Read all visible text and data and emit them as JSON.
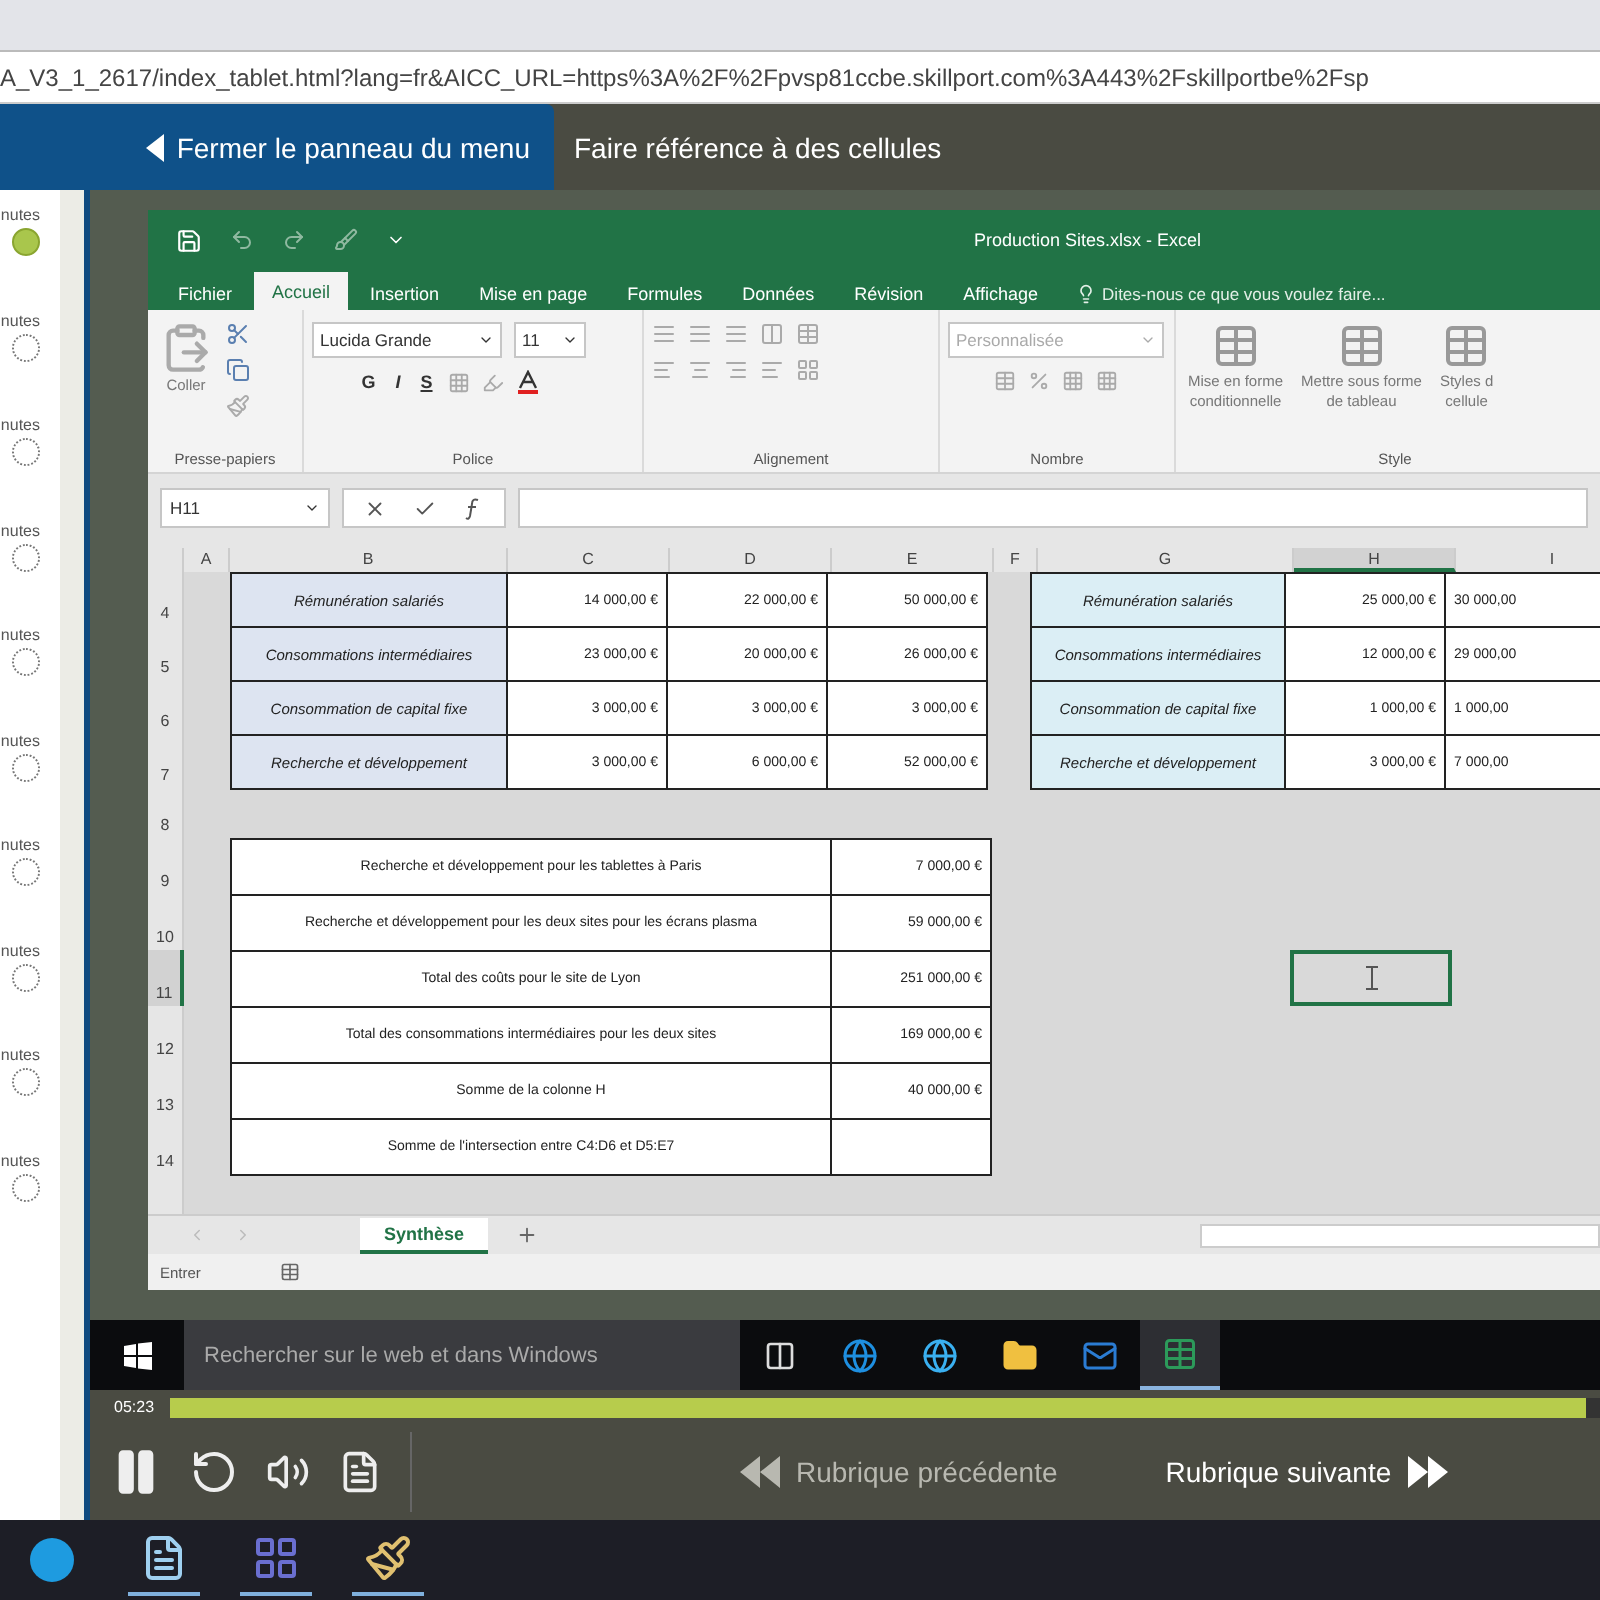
{
  "browser": {
    "url": "A_V3_1_2617/index_tablet.html?lang=fr&AICC_URL=https%3A%2F%2Fpvsp81ccbe.skillport.com%3A443%2Fskillportbe%2Fsp"
  },
  "header": {
    "close_menu": "Fermer le panneau du menu",
    "topic_title": "Faire référence à des cellules"
  },
  "sidebar": {
    "items": [
      {
        "label": "nutes",
        "completed": true
      },
      {
        "label": "nutes",
        "completed": false
      },
      {
        "label": "nutes",
        "completed": false
      },
      {
        "label": "nutes",
        "completed": false
      },
      {
        "label": "nutes",
        "completed": false
      },
      {
        "label": "nutes",
        "completed": false
      },
      {
        "label": "nutes",
        "completed": false
      },
      {
        "label": "nutes",
        "completed": false
      },
      {
        "label": "nutes",
        "completed": false
      },
      {
        "label": "nutes",
        "completed": false
      }
    ]
  },
  "excel": {
    "title": "Production Sites.xlsx - Excel",
    "tabs": [
      {
        "label": "Fichier",
        "selected": false
      },
      {
        "label": "Accueil",
        "selected": true
      },
      {
        "label": "Insertion",
        "selected": false
      },
      {
        "label": "Mise en page",
        "selected": false
      },
      {
        "label": "Formules",
        "selected": false
      },
      {
        "label": "Données",
        "selected": false
      },
      {
        "label": "Révision",
        "selected": false
      },
      {
        "label": "Affichage",
        "selected": false
      }
    ],
    "tell_me": "Dites-nous ce que vous voulez faire...",
    "ribbon": {
      "paste": "Coller",
      "font_name": "Lucida Grande",
      "font_size": "11",
      "bold": "G",
      "italic": "I",
      "underline": "S",
      "number_format": "Personnalisée",
      "conditional": [
        "Mise en forme",
        "conditionnelle"
      ],
      "table_format": [
        "Mettre sous forme",
        "de tableau"
      ],
      "cell_styles": [
        "Styles d",
        "cellule"
      ],
      "groups": [
        "Presse-papiers",
        "Police",
        "Alignement",
        "Nombre",
        "Style"
      ]
    },
    "name_box": "H11",
    "columns": [
      {
        "label": "A",
        "selected": false
      },
      {
        "label": "B",
        "selected": false
      },
      {
        "label": "C",
        "selected": false
      },
      {
        "label": "D",
        "selected": false
      },
      {
        "label": "E",
        "selected": false
      },
      {
        "label": "F",
        "selected": false
      },
      {
        "label": "G",
        "selected": false
      },
      {
        "label": "H",
        "selected": true
      },
      {
        "label": "I",
        "selected": false
      }
    ],
    "top_rows": [
      {
        "number": "4",
        "left_label": "Rémunération salariés",
        "left_values": [
          "14 000,00 €",
          "22 000,00 €",
          "50 000,00 €"
        ],
        "right_label": "Rémunération salariés",
        "right_values": [
          "25 000,00 €",
          "30 000,00"
        ]
      },
      {
        "number": "5",
        "left_label": "Consommations intermédiaires",
        "left_values": [
          "23 000,00 €",
          "20 000,00 €",
          "26 000,00 €"
        ],
        "right_label": "Consommations intermédiaires",
        "right_values": [
          "12 000,00 €",
          "29 000,00"
        ]
      },
      {
        "number": "6",
        "left_label": "Consommation de capital fixe",
        "left_values": [
          "3 000,00 €",
          "3 000,00 €",
          "3 000,00 €"
        ],
        "right_label": "Consommation de capital fixe",
        "right_values": [
          "1 000,00 €",
          "1 000,00"
        ]
      },
      {
        "number": "7",
        "left_label": "Recherche et développement",
        "left_values": [
          "3 000,00 €",
          "6 000,00 €",
          "52 000,00 €"
        ],
        "right_label": "Recherche et développement",
        "right_values": [
          "3 000,00 €",
          "7 000,00"
        ]
      }
    ],
    "gap_row": "8",
    "bottom_rows": [
      {
        "number": "9",
        "label": "Recherche et développement pour les tablettes à Paris",
        "value": "7 000,00 €",
        "selected": false
      },
      {
        "number": "10",
        "label": "Recherche et développement pour les deux sites pour les écrans plasma",
        "value": "59 000,00 €",
        "selected": false
      },
      {
        "number": "11",
        "label": "Total des coûts pour le site de Lyon",
        "value": "251 000,00 €",
        "selected": true
      },
      {
        "number": "12",
        "label": "Total des consommations intermédiaires pour les deux sites",
        "value": "169 000,00 €",
        "selected": false
      },
      {
        "number": "13",
        "label": "Somme de la colonne H",
        "value": "40 000,00 €",
        "selected": false
      },
      {
        "number": "14",
        "label": "Somme de l'intersection entre C4:D6 et D5:E7",
        "selected": false
      }
    ],
    "sheet_tab": "Synthèse",
    "status": "Entrer"
  },
  "taskbar": {
    "search": "Rechercher sur le web et dans Windows"
  },
  "player": {
    "time": "05:23",
    "level": 0.99,
    "previous": {
      "label": "Rubrique précédente",
      "disabled": true
    },
    "next": {
      "label": "Rubrique suivante",
      "disabled": false
    }
  }
}
